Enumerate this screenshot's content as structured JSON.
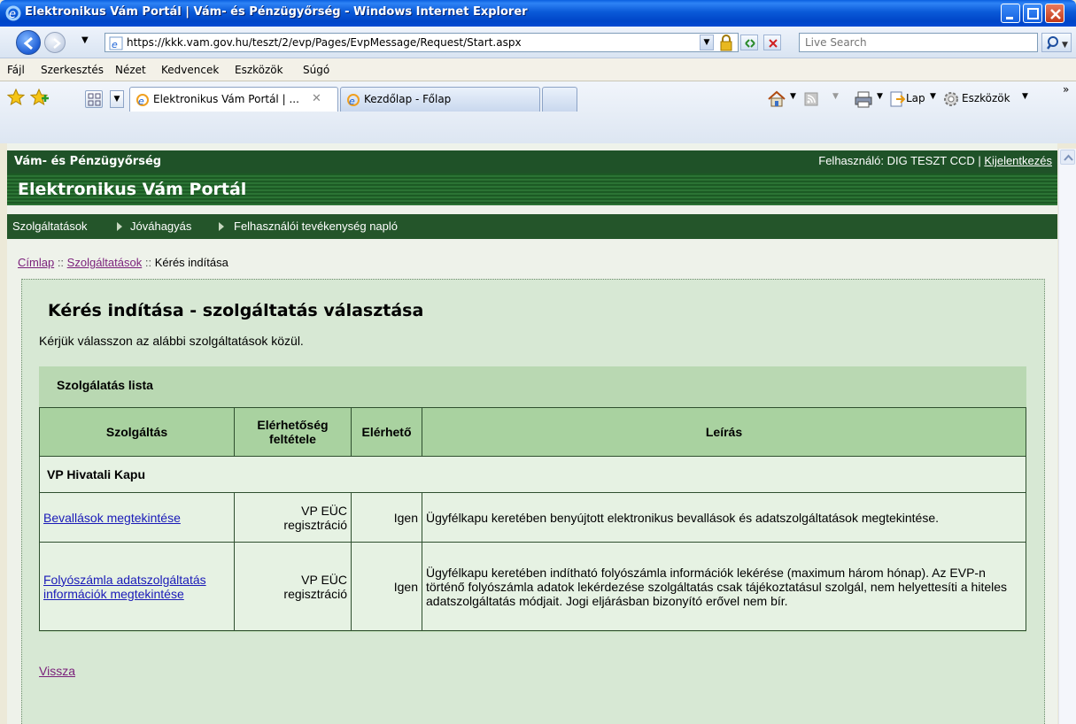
{
  "window": {
    "title": "Elektronikus Vám Portál | Vám- és Pénzügyőrség - Windows Internet Explorer"
  },
  "address_bar": {
    "url": "https://kkk.vam.gov.hu/teszt/2/evp/Pages/EvpMessage/Request/Start.aspx",
    "search_placeholder": "Live Search"
  },
  "menu": {
    "items": [
      "Fájl",
      "Szerkesztés",
      "Nézet",
      "Kedvencek",
      "Eszközök",
      "Súgó"
    ]
  },
  "tabs": [
    {
      "label": "Elektronikus Vám Portál | ..."
    },
    {
      "label": "Kezdőlap - Főlap"
    }
  ],
  "command_bar": {
    "page_label": "Lap",
    "tools_label": "Eszközök"
  },
  "header": {
    "organization": "Vám- és Pénzügyőrség",
    "user_prefix": "Felhasználó: DIG TESZT CCD | ",
    "logout_label": "Kijelentkezés",
    "portal_title": "Elektronikus Vám Portál"
  },
  "nav": {
    "items": [
      "Szolgáltatások",
      "Jóváhagyás",
      "Felhasználói tevékenység napló"
    ]
  },
  "breadcrumb": {
    "home": "Címlap",
    "services": "Szolgáltatások",
    "current": "Kérés indítása",
    "sep": "::"
  },
  "main": {
    "title": "Kérés indítása - szolgáltatás választása",
    "intro": "Kérjük válasszon az alábbi szolgáltatások közül.",
    "list_title": "Szolgálatás lista",
    "columns": [
      "Szolgáltás",
      "Elérhetőség feltétele",
      "Elérhető",
      "Leírás"
    ],
    "group_label": "VP Hivatali Kapu",
    "rows": [
      {
        "service": "Bevallások megtekintése",
        "condition": "VP EÜC regisztráció",
        "available": "Igen",
        "description": "Ügyfélkapu keretében benyújtott elektronikus bevallások és adatszolgáltatások megtekintése."
      },
      {
        "service": "Folyószámla adatszolgáltatás információk megtekintése",
        "condition": "VP EÜC regisztráció",
        "available": "Igen",
        "description": "Ügyfélkapu keretében indítható folyószámla információk lekérése (maximum három hónap). Az EVP-n történő folyószámla adatok lekérdezése szolgáltatás csak tájékoztatásul szolgál, nem helyettesíti a hiteles adatszolgáltatás módjait. Jogi eljárásban bizonyító erővel nem bír."
      }
    ],
    "back_label": "Vissza"
  }
}
